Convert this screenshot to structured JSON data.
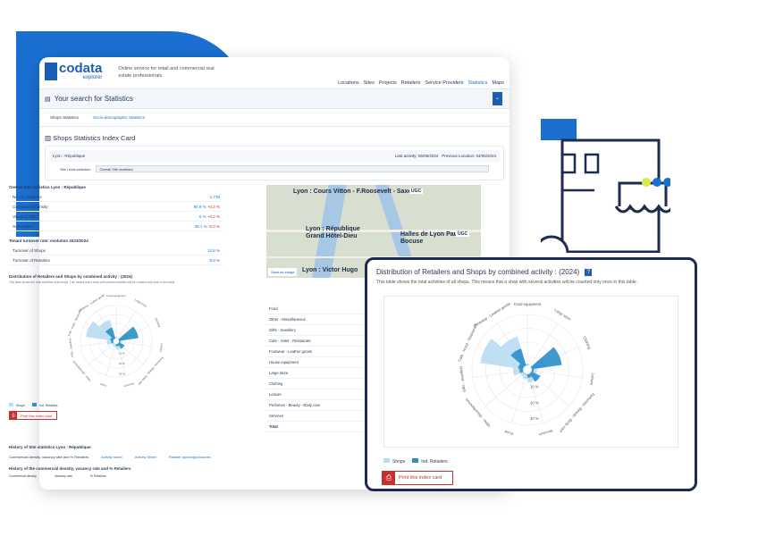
{
  "app": {
    "logo_text": "codata",
    "logo_sub": "explorer",
    "tagline": "Online service for retail and commercial real estate professionals"
  },
  "nav": [
    "Locations",
    "Sites",
    "Projects",
    "Retailers",
    "Service Providers",
    "Statistics",
    "Maps"
  ],
  "nav_active": "Statistics",
  "search_title": "Your search for Statistics",
  "tabs": [
    "Shops Statistics",
    "Socio-demographic Statistics"
  ],
  "section_title": "Shops Statistics Index Card",
  "card": {
    "location": "Lyon : République",
    "last_activity": "Last activity: 06/06/2024",
    "previous": "Previous Location: 04/06/2024"
  },
  "site_selection": {
    "label": "Site / Axis selection",
    "value": "Overall Site statistics"
  },
  "overall": {
    "title": "Overall Site statistics Lyon : République",
    "rows": [
      {
        "label": "No. of Locations",
        "value": "1,738",
        "change": ""
      },
      {
        "label": "Commercial density",
        "value": "90.8 %",
        "change": "+0.2 %"
      },
      {
        "label": "Vacancy rate",
        "value": "6 %",
        "change": "+0.2 %"
      },
      {
        "label": "% Retailers",
        "value": "38.1 %",
        "change": "-0.3 %"
      }
    ]
  },
  "turnover": {
    "title": "Tenant turnover rate: evolution 2023/2024",
    "rows": [
      {
        "label": "Turnover of Shops",
        "value": "12.8 %"
      },
      {
        "label": "Turnover of Retailers",
        "value": "8.8 %"
      }
    ]
  },
  "map": {
    "labels": [
      "Lyon : Cours Vitton - F.Roosevelt - Saxe",
      "Lyon : République Grand Hôtel-Dieu",
      "Halles de Lyon Paul Bocuse",
      "Lyon : Victor Hugo",
      "UGC",
      "UGC"
    ],
    "button": "Save as image"
  },
  "left_chart": {
    "title": "Distribution of Retailers and Shops by combined activity : (2024)",
    "desc": "This table shows the total activities of all shops. This means that a shop with several activities will be counted only once in this table.",
    "legend": [
      "Shops",
      "Ind. Retailers"
    ]
  },
  "activity_table": [
    "Food",
    "Other - Miscellaneous",
    "Gifts - Jewellery",
    "Cafe - Hotel - Restaurant",
    "Footwear - Leather goods",
    "House equipment",
    "Large store",
    "Clothing",
    "Leisure",
    "Perfumes - Beauty - Body care",
    "Services",
    "Total"
  ],
  "print_label": "Print this index card",
  "history": {
    "title": "History of Site statistics Lyon : République",
    "tabs": [
      "Commercial density, vacancy rate and % Retailers",
      "Activity sheet",
      "Activity Sheet",
      "Retailer openings/closures"
    ],
    "chart_title": "History of the commercial density, vacancy rate and % Retailers",
    "legend": [
      "Commercial density",
      "Vacancy rate",
      "% Retailers"
    ]
  },
  "popup": {
    "title": "Distribution of Retailers and Shops by combined activity : (2024)",
    "desc": "This table shows the total activities of all shops. This means that a shop with several activities will be counted only once in this table.",
    "legend": [
      "Shops",
      "Ind. Retailers"
    ],
    "print_label": "Print this index card"
  },
  "chart_data": {
    "type": "polar-area",
    "title": "Distribution of Retailers and Shops by combined activity : (2024)",
    "categories": [
      "Food equipment",
      "Large store",
      "Clothing",
      "Leisure",
      "Perfumes - Beauty - Body care",
      "Services",
      "Food",
      "Other - Miscellaneous",
      "Gifts - Jewellery",
      "Cafe - Hotel - Restaurant",
      "Footwear - Leather goods"
    ],
    "ring_labels": [
      "10 %",
      "20 %",
      "30 %"
    ],
    "rmax": 35,
    "series": [
      {
        "name": "Shops",
        "values": [
          4,
          3,
          12,
          6,
          6,
          8,
          6,
          5,
          9,
          30,
          22
        ]
      },
      {
        "name": "Ind. Retailers",
        "values": [
          3,
          2,
          22,
          4,
          9,
          5,
          3,
          3,
          5,
          6,
          14
        ]
      }
    ],
    "colors": [
      "#b9dcf2",
      "#2a8fc9"
    ]
  },
  "colors": {
    "accent": "#1a5fb4",
    "blob": "#1a6fd0",
    "print": "#c53030",
    "popup_border": "#1d2c4e",
    "shop_yellow": "#d9e84a"
  }
}
